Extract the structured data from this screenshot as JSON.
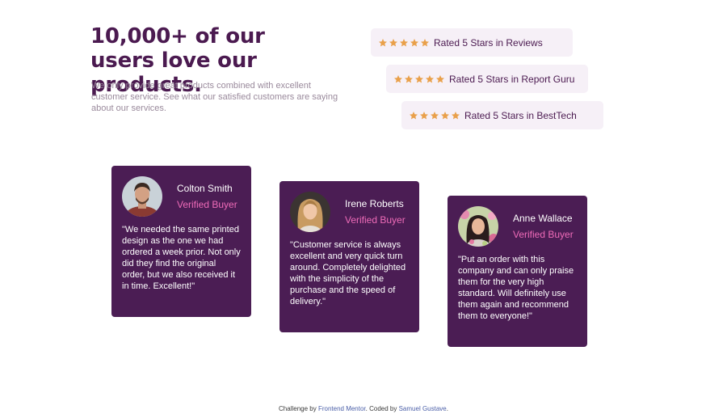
{
  "header": {
    "title": "10,000+ of our users love our products.",
    "description": "We only provide great products combined with excellent customer service. See what our satisfied customers are saying about our services."
  },
  "ratings": [
    {
      "stars": 5,
      "label": "Rated 5 Stars in Reviews"
    },
    {
      "stars": 5,
      "label": "Rated 5 Stars in Report Guru"
    },
    {
      "stars": 5,
      "label": "Rated 5 Stars in BestTech"
    }
  ],
  "testimonials": [
    {
      "name": "Colton Smith",
      "role": "Verified Buyer",
      "quote": "\"We needed the same printed design as the one we had ordered a week prior. Not only did they find the original order, but we also received it in time. Excellent!\""
    },
    {
      "name": "Irene Roberts",
      "role": "Verified Buyer",
      "quote": "\"Customer service is always excellent and very quick turn around. Completely delighted with the simplicity of the purchase and the speed of delivery.\""
    },
    {
      "name": "Anne Wallace",
      "role": "Verified Buyer",
      "quote": "\"Put an order with this company and can only praise them for the very high standard. Will definitely use them again and recommend them to everyone!\""
    }
  ],
  "attribution": {
    "prefix": "Challenge by",
    "link1": "Frontend Mentor",
    "middle": ". Coded by",
    "link2": "Samuel Gustave",
    "suffix": "."
  },
  "colors": {
    "primary": "#4b1a50",
    "card_background": "#4b1d54",
    "accent_pink": "#ee6bb8",
    "star": "#e9a04a",
    "rating_background": "#f6f0f7",
    "muted_text": "#9a8a9c"
  },
  "icons": {
    "rating_star": "star-icon"
  }
}
